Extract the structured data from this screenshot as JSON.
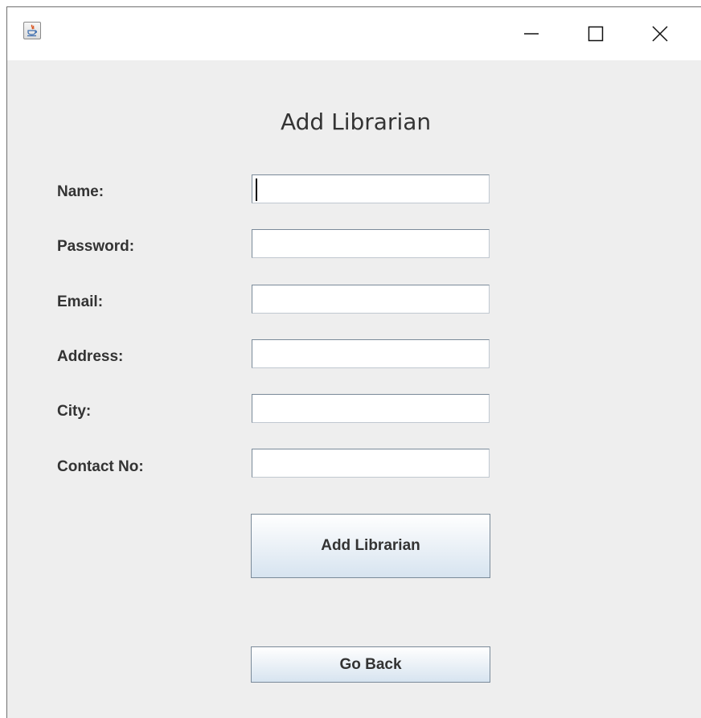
{
  "window": {
    "icon": "java-icon",
    "controls": {
      "minimize": "minimize-icon",
      "maximize": "maximize-icon",
      "close": "close-icon"
    }
  },
  "form": {
    "title": "Add Librarian",
    "fields": [
      {
        "label": "Name:",
        "value": ""
      },
      {
        "label": "Password:",
        "value": ""
      },
      {
        "label": "Email:",
        "value": ""
      },
      {
        "label": "Address:",
        "value": ""
      },
      {
        "label": "City:",
        "value": ""
      },
      {
        "label": "Contact No:",
        "value": ""
      }
    ],
    "submit_label": "Add Librarian",
    "back_label": "Go Back"
  },
  "colors": {
    "window_bg": "#eeeeee",
    "button_gradient_bottom": "#d7e4f0",
    "text": "#333333"
  }
}
